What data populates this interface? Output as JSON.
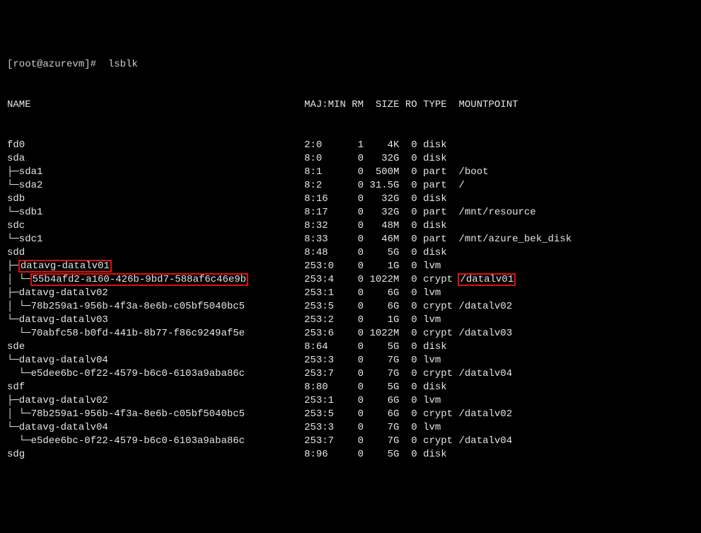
{
  "prompt": {
    "text": "[root@azurevm]#  lsblk"
  },
  "header": {
    "name": "NAME",
    "majmin": "MAJ:MIN",
    "rm": "RM",
    "size": "SIZE",
    "ro": "RO",
    "type": "TYPE",
    "mount": "MOUNTPOINT"
  },
  "rows": [
    {
      "prefix": "",
      "name": "fd0",
      "majmin": "2:0",
      "rm": "1",
      "size": "4K",
      "ro": "0",
      "type": "disk",
      "mount": "",
      "hlName": false,
      "hlMount": false
    },
    {
      "prefix": "",
      "name": "sda",
      "majmin": "8:0",
      "rm": "0",
      "size": "32G",
      "ro": "0",
      "type": "disk",
      "mount": "",
      "hlName": false,
      "hlMount": false
    },
    {
      "prefix": "├─",
      "name": "sda1",
      "majmin": "8:1",
      "rm": "0",
      "size": "500M",
      "ro": "0",
      "type": "part",
      "mount": "/boot",
      "hlName": false,
      "hlMount": false
    },
    {
      "prefix": "└─",
      "name": "sda2",
      "majmin": "8:2",
      "rm": "0",
      "size": "31.5G",
      "ro": "0",
      "type": "part",
      "mount": "/",
      "hlName": false,
      "hlMount": false
    },
    {
      "prefix": "",
      "name": "sdb",
      "majmin": "8:16",
      "rm": "0",
      "size": "32G",
      "ro": "0",
      "type": "disk",
      "mount": "",
      "hlName": false,
      "hlMount": false
    },
    {
      "prefix": "└─",
      "name": "sdb1",
      "majmin": "8:17",
      "rm": "0",
      "size": "32G",
      "ro": "0",
      "type": "part",
      "mount": "/mnt/resource",
      "hlName": false,
      "hlMount": false
    },
    {
      "prefix": "",
      "name": "sdc",
      "majmin": "8:32",
      "rm": "0",
      "size": "48M",
      "ro": "0",
      "type": "disk",
      "mount": "",
      "hlName": false,
      "hlMount": false
    },
    {
      "prefix": "└─",
      "name": "sdc1",
      "majmin": "8:33",
      "rm": "0",
      "size": "46M",
      "ro": "0",
      "type": "part",
      "mount": "/mnt/azure_bek_disk",
      "hlName": false,
      "hlMount": false
    },
    {
      "prefix": "",
      "name": "sdd",
      "majmin": "8:48",
      "rm": "0",
      "size": "5G",
      "ro": "0",
      "type": "disk",
      "mount": "",
      "hlName": false,
      "hlMount": false
    },
    {
      "prefix": "├─",
      "name": "datavg-datalv01",
      "majmin": "253:0",
      "rm": "0",
      "size": "1G",
      "ro": "0",
      "type": "lvm",
      "mount": "",
      "hlName": true,
      "hlMount": false
    },
    {
      "prefix": "│ └─",
      "name": "55b4afd2-a160-426b-9bd7-588af6c46e9b",
      "majmin": "253:4",
      "rm": "0",
      "size": "1022M",
      "ro": "0",
      "type": "crypt",
      "mount": "/datalv01",
      "hlName": true,
      "hlMount": true
    },
    {
      "prefix": "├─",
      "name": "datavg-datalv02",
      "majmin": "253:1",
      "rm": "0",
      "size": "6G",
      "ro": "0",
      "type": "lvm",
      "mount": "",
      "hlName": false,
      "hlMount": false
    },
    {
      "prefix": "│ └─",
      "name": "78b259a1-956b-4f3a-8e6b-c05bf5040bc5",
      "majmin": "253:5",
      "rm": "0",
      "size": "6G",
      "ro": "0",
      "type": "crypt",
      "mount": "/datalv02",
      "hlName": false,
      "hlMount": false
    },
    {
      "prefix": "└─",
      "name": "datavg-datalv03",
      "majmin": "253:2",
      "rm": "0",
      "size": "1G",
      "ro": "0",
      "type": "lvm",
      "mount": "",
      "hlName": false,
      "hlMount": false
    },
    {
      "prefix": "  └─",
      "name": "70abfc58-b0fd-441b-8b77-f86c9249af5e",
      "majmin": "253:6",
      "rm": "0",
      "size": "1022M",
      "ro": "0",
      "type": "crypt",
      "mount": "/datalv03",
      "hlName": false,
      "hlMount": false
    },
    {
      "prefix": "",
      "name": "sde",
      "majmin": "8:64",
      "rm": "0",
      "size": "5G",
      "ro": "0",
      "type": "disk",
      "mount": "",
      "hlName": false,
      "hlMount": false
    },
    {
      "prefix": "└─",
      "name": "datavg-datalv04",
      "majmin": "253:3",
      "rm": "0",
      "size": "7G",
      "ro": "0",
      "type": "lvm",
      "mount": "",
      "hlName": false,
      "hlMount": false
    },
    {
      "prefix": "  └─",
      "name": "e5dee6bc-0f22-4579-b6c0-6103a9aba86c",
      "majmin": "253:7",
      "rm": "0",
      "size": "7G",
      "ro": "0",
      "type": "crypt",
      "mount": "/datalv04",
      "hlName": false,
      "hlMount": false
    },
    {
      "prefix": "",
      "name": "sdf",
      "majmin": "8:80",
      "rm": "0",
      "size": "5G",
      "ro": "0",
      "type": "disk",
      "mount": "",
      "hlName": false,
      "hlMount": false
    },
    {
      "prefix": "├─",
      "name": "datavg-datalv02",
      "majmin": "253:1",
      "rm": "0",
      "size": "6G",
      "ro": "0",
      "type": "lvm",
      "mount": "",
      "hlName": false,
      "hlMount": false
    },
    {
      "prefix": "│ └─",
      "name": "78b259a1-956b-4f3a-8e6b-c05bf5040bc5",
      "majmin": "253:5",
      "rm": "0",
      "size": "6G",
      "ro": "0",
      "type": "crypt",
      "mount": "/datalv02",
      "hlName": false,
      "hlMount": false
    },
    {
      "prefix": "└─",
      "name": "datavg-datalv04",
      "majmin": "253:3",
      "rm": "0",
      "size": "7G",
      "ro": "0",
      "type": "lvm",
      "mount": "",
      "hlName": false,
      "hlMount": false
    },
    {
      "prefix": "  └─",
      "name": "e5dee6bc-0f22-4579-b6c0-6103a9aba86c",
      "majmin": "253:7",
      "rm": "0",
      "size": "7G",
      "ro": "0",
      "type": "crypt",
      "mount": "/datalv04",
      "hlName": false,
      "hlMount": false
    },
    {
      "prefix": "",
      "name": "sdg",
      "majmin": "8:96",
      "rm": "0",
      "size": "5G",
      "ro": "0",
      "type": "disk",
      "mount": "",
      "hlName": false,
      "hlMount": false
    }
  ]
}
